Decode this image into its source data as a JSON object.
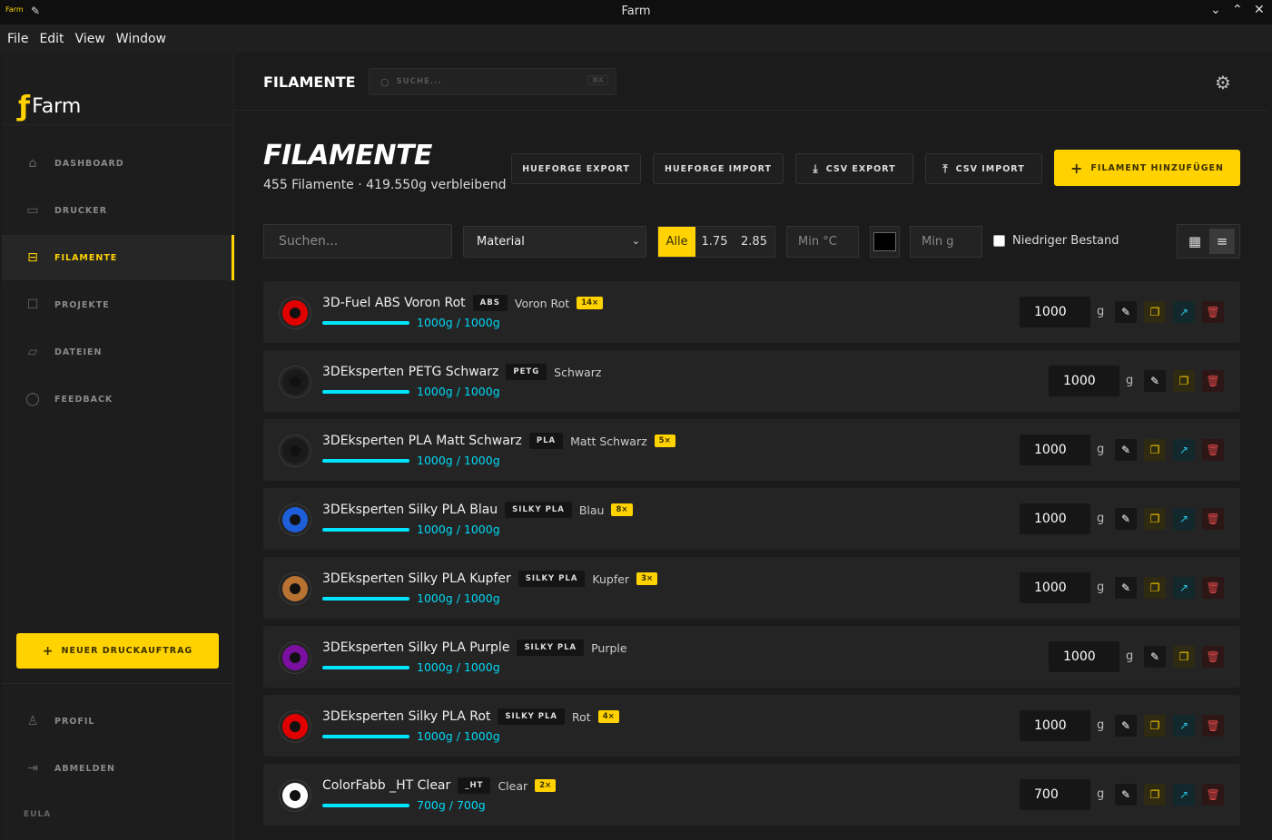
{
  "window": {
    "title": "Farm",
    "app_icon_text": "Farm"
  },
  "menu": [
    "File",
    "Edit",
    "View",
    "Window"
  ],
  "sidebar": {
    "logo_text": "Farm",
    "items": [
      {
        "label": "DASHBOARD",
        "icon": "home-icon",
        "glyph": "⌂"
      },
      {
        "label": "DRUCKER",
        "icon": "printer-icon",
        "glyph": "▭"
      },
      {
        "label": "FILAMENTE",
        "icon": "spool-icon",
        "glyph": "⊟",
        "active": true
      },
      {
        "label": "PROJEKTE",
        "icon": "clipboard-icon",
        "glyph": "☐"
      },
      {
        "label": "DATEIEN",
        "icon": "folder-icon",
        "glyph": "▱"
      },
      {
        "label": "FEEDBACK",
        "icon": "chat-icon",
        "glyph": "◯"
      }
    ],
    "new_job_label": "NEUER DRUCKAUFTRAG",
    "bottom_items": [
      {
        "label": "PROFIL",
        "icon": "user-icon",
        "glyph": "♙"
      },
      {
        "label": "ABMELDEN",
        "icon": "logout-icon",
        "glyph": "⇥"
      }
    ],
    "eula": "EULA"
  },
  "topbar": {
    "breadcrumb": "FILAMENTE",
    "search_placeholder": "SUCHE...",
    "shortcut": "⌘K"
  },
  "page": {
    "title": "FILAMENTE",
    "subtitle": "455 Filamente · 419.550g verbleibend",
    "buttons": {
      "hueforge_export": "HUEFORGE EXPORT",
      "hueforge_import": "HUEFORGE IMPORT",
      "csv_export": "CSV EXPORT",
      "csv_import": "CSV IMPORT",
      "add": "FILAMENT HINZUFÜGEN"
    }
  },
  "filters": {
    "search_placeholder": "Suchen...",
    "material_selected": "Material",
    "diameter_options": [
      "Alle",
      "1.75",
      "2.85"
    ],
    "diameter_selected": "Alle",
    "min_temp_placeholder": "Min °C",
    "color_value": "#000000",
    "min_weight_placeholder": "Min g",
    "low_stock_label": "Niedriger Bestand",
    "low_stock_checked": false,
    "view_mode": "list"
  },
  "filaments": [
    {
      "name": "3D-Fuel ABS Voron Rot",
      "material": "ABS",
      "color_name": "Voron Rot",
      "count": "14×",
      "color": "#e00000",
      "stock": "1000g / 1000g",
      "fill": 1.0,
      "qty": "1000"
    },
    {
      "name": "3DEksperten PETG Schwarz",
      "material": "PETG",
      "color_name": "Schwarz",
      "count": "",
      "color": "#1a1a1a",
      "stock": "1000g / 1000g",
      "fill": 1.0,
      "qty": "1000"
    },
    {
      "name": "3DEksperten PLA Matt Schwarz",
      "material": "PLA",
      "color_name": "Matt Schwarz",
      "count": "5×",
      "color": "#1a1a1a",
      "stock": "1000g / 1000g",
      "fill": 1.0,
      "qty": "1000"
    },
    {
      "name": "3DEksperten Silky PLA Blau",
      "material": "SILKY PLA",
      "color_name": "Blau",
      "count": "8×",
      "color": "#1e5ed8",
      "stock": "1000g / 1000g",
      "fill": 1.0,
      "qty": "1000"
    },
    {
      "name": "3DEksperten Silky PLA Kupfer",
      "material": "SILKY PLA",
      "color_name": "Kupfer",
      "count": "3×",
      "color": "#b87333",
      "stock": "1000g / 1000g",
      "fill": 1.0,
      "qty": "1000"
    },
    {
      "name": "3DEksperten Silky PLA Purple",
      "material": "SILKY PLA",
      "color_name": "Purple",
      "count": "",
      "color": "#7a0fa0",
      "stock": "1000g / 1000g",
      "fill": 1.0,
      "qty": "1000"
    },
    {
      "name": "3DEksperten Silky PLA Rot",
      "material": "SILKY PLA",
      "color_name": "Rot",
      "count": "4×",
      "color": "#e00000",
      "stock": "1000g / 1000g",
      "fill": 1.0,
      "qty": "1000"
    },
    {
      "name": "ColorFabb _HT Clear",
      "material": "_HT",
      "color_name": "Clear",
      "count": "2×",
      "color": "#ffffff",
      "stock": "700g / 700g",
      "fill": 1.0,
      "qty": "700"
    }
  ],
  "unit": "g",
  "colors": {
    "accent": "#ffd200",
    "stock_bar": "#00e5ff",
    "danger": "#e04848",
    "link": "#2bc4e4"
  }
}
